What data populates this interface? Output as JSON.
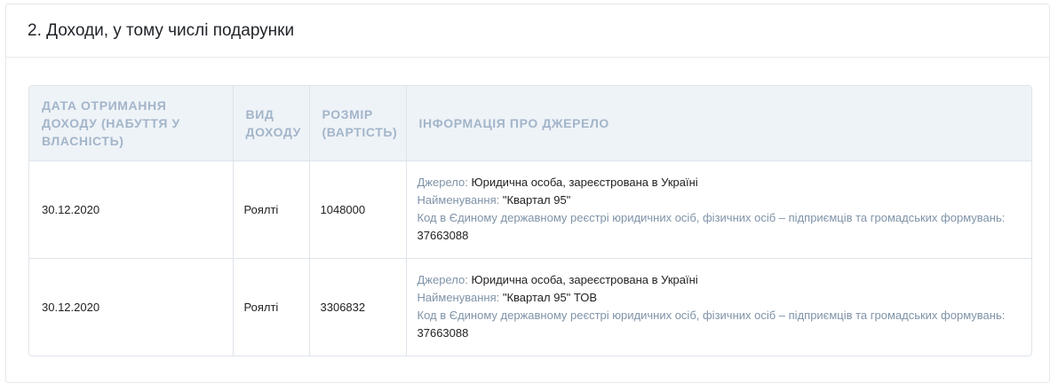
{
  "section": {
    "title": "2. Доходи, у тому числі подарунки"
  },
  "table": {
    "headers": [
      "ДАТА ОТРИМАННЯ ДОХОДУ (НАБУТТЯ У ВЛАСНІСТЬ)",
      "ВИД ДОХОДУ",
      "РОЗМІР (ВАРТІСТЬ)",
      "ІНФОРМАЦІЯ ПРО ДЖЕРЕЛО"
    ],
    "rows": [
      {
        "date": "30.12.2020",
        "type": "Роялті",
        "amount": "1048000",
        "source_label": "Джерело:",
        "source_value": "Юридична особа, зареєстрована в Україні",
        "name_label": "Найменування:",
        "name_value": "\"Квартал 95\"",
        "code_label": "Код в Єдиному державному реєстрі юридичних осіб, фізичних осіб – підприємців та громадських формувань:",
        "code_value": "37663088"
      },
      {
        "date": "30.12.2020",
        "type": "Роялті",
        "amount": "3306832",
        "source_label": "Джерело:",
        "source_value": "Юридична особа, зареєстрована в Україні",
        "name_label": "Найменування:",
        "name_value": "\"Квартал 95\" ТОВ",
        "code_label": "Код в Єдиному державному реєстрі юридичних осіб, фізичних осіб – підприємців та громадських формувань:",
        "code_value": "37663088"
      }
    ]
  }
}
